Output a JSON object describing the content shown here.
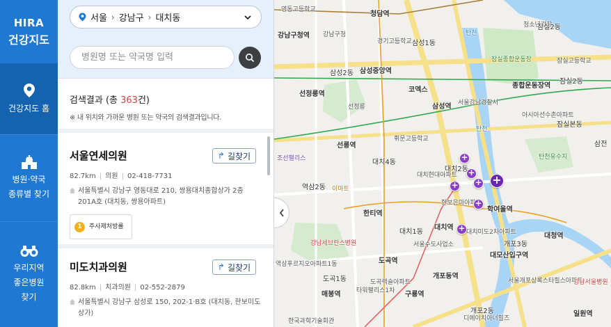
{
  "app": {
    "logo_line1": "HIRA",
    "logo_line2": "건강지도"
  },
  "nav": {
    "home_label": "건강지도 홈",
    "find_label_1": "병원·약국",
    "find_label_2": "종류별 찾기",
    "good_label_1": "우리지역",
    "good_label_2": "좋은병원",
    "good_label_3": "찾기"
  },
  "region": {
    "city": "서울",
    "district": "강남구",
    "dong": "대치동"
  },
  "search": {
    "placeholder": "병원명 또는 약국명 입력"
  },
  "results": {
    "prefix": "검색결과 (총 ",
    "count": "363",
    "suffix": "건)",
    "note": "※ 내 위치와 가까운 병원 또는 약국의 검색결과입니다."
  },
  "items": [
    {
      "name": "서울연세의원",
      "route_label": "길찾기",
      "distance": "82.7km",
      "type": "의원",
      "phone": "02-418-7731",
      "address": "서울특별시 강남구 영동대로 210, 쌍용대치종합상가 2층 201A호 (대치동, 쌍용아파트)",
      "badge_num": "1",
      "badge_text": "주사제처방률"
    },
    {
      "name": "미도치과의원",
      "route_label": "길찾기",
      "distance": "82.8km",
      "type": "치과의원",
      "phone": "02-552-2879",
      "address": "서울특별시 강남구 삼성로 150, 202-1·B호 (대치동, 한보미도상가)"
    }
  ],
  "map": {
    "labels": {
      "a": "영동고등학교",
      "b": "청담역",
      "c": "청소년광장",
      "d": "잠실2동",
      "e": "탄천",
      "f": "강남구청역",
      "g": "강남구청",
      "h": "경기고등학교",
      "i": "삼성1동",
      "j": "잠실종합운동장",
      "k": "잠실고등학교",
      "l": "삼성2동",
      "m": "삼성중앙역",
      "n": "코엑스",
      "o": "종합운동장역",
      "p": "잠실2동",
      "q": "선정릉역",
      "r": "선정릉",
      "s": "삼성역",
      "t": "서울강남경찰서",
      "u": "아시아선수촌아파트",
      "v": "잠실본동",
      "w": "휘문고등학교",
      "x": "탄천",
      "y": "선릉역",
      "z": "조선팰리스",
      "aa": "대치4동",
      "ab": "대치2동",
      "ac": "대치현대아파트",
      "ad": "탄천유수지",
      "ae": "역삼2동",
      "af": "이마트",
      "ag": "한보은마아파트",
      "ah": "학여울역",
      "ai": "한티역",
      "aj": "대치1동",
      "ak": "대치역",
      "al": "대치미도2차아파트",
      "am": "개포3동",
      "an": "강남세브란스병원",
      "ao": "대모산입구역",
      "ap": "대청역",
      "aq": "역삼푸르지오아파트1동",
      "ar": "도곡역",
      "as": "도곡렉슬아파트",
      "at": "서울수도사업소",
      "au": "도곡1동",
      "av": "매봉역",
      "aw": "개포동역",
      "ax": "타워팰리스1차",
      "ay": "서울개포상록스타힐스아파트",
      "az": "강남서울병원",
      "ba": "구룡역",
      "bb": "한국과학기술회관",
      "bc": "개포2동",
      "bd": "디에이치아너힐즈",
      "be": "일원역",
      "bf": "삼전"
    }
  },
  "colors": {
    "nav": "#1f78d1",
    "accent": "#e0403a",
    "marker": "#8a3ec4"
  }
}
